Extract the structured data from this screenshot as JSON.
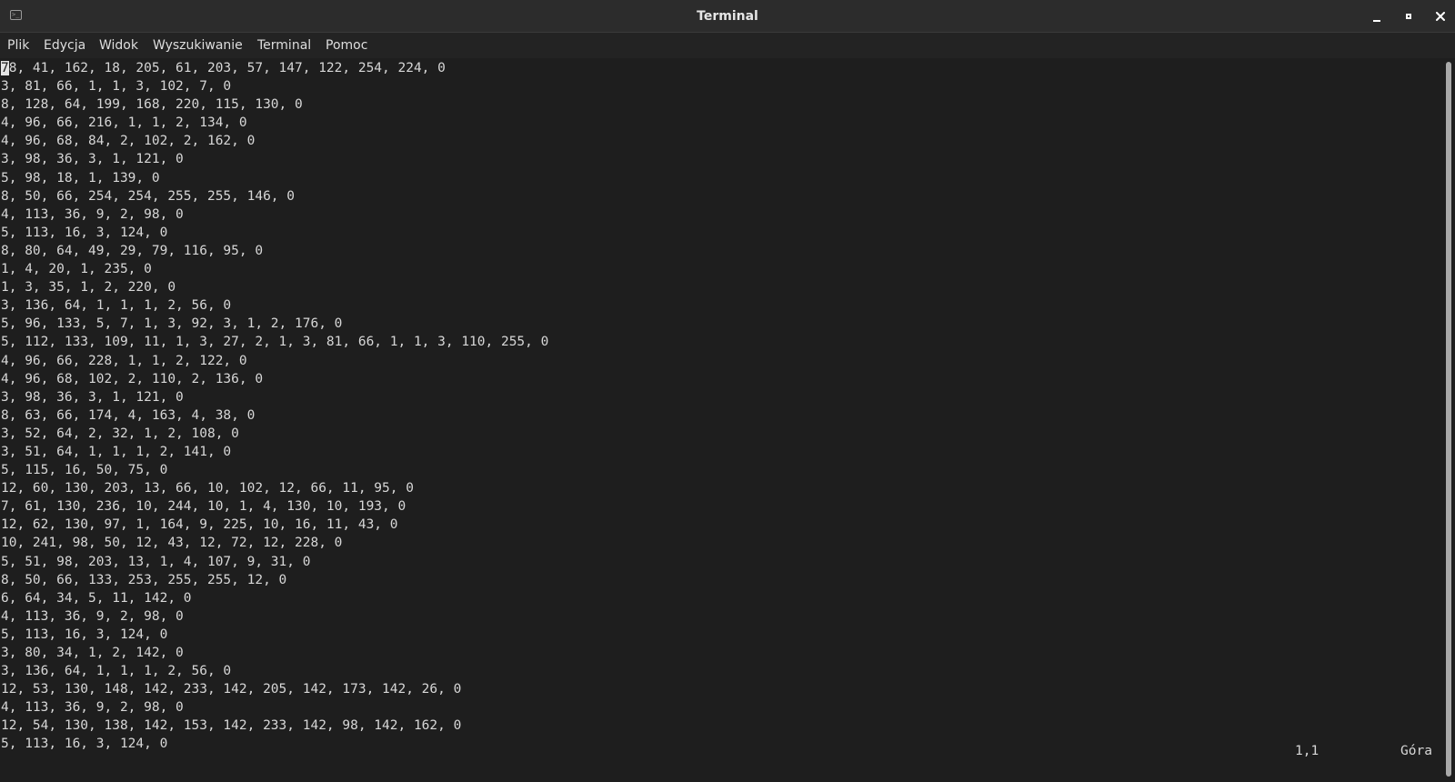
{
  "window": {
    "title": "Terminal"
  },
  "menu": {
    "items": [
      "Plik",
      "Edycja",
      "Widok",
      "Wyszukiwanie",
      "Terminal",
      "Pomoc"
    ]
  },
  "terminal": {
    "cursor_char": "7",
    "first_line_rest": "8, 41, 162, 18, 205, 61, 203, 57, 147, 122, 254, 224, 0",
    "lines": [
      "3, 81, 66, 1, 1, 3, 102, 7, 0",
      "8, 128, 64, 199, 168, 220, 115, 130, 0",
      "4, 96, 66, 216, 1, 1, 2, 134, 0",
      "4, 96, 68, 84, 2, 102, 2, 162, 0",
      "3, 98, 36, 3, 1, 121, 0",
      "5, 98, 18, 1, 139, 0",
      "8, 50, 66, 254, 254, 255, 255, 146, 0",
      "4, 113, 36, 9, 2, 98, 0",
      "5, 113, 16, 3, 124, 0",
      "8, 80, 64, 49, 29, 79, 116, 95, 0",
      "1, 4, 20, 1, 235, 0",
      "1, 3, 35, 1, 2, 220, 0",
      "3, 136, 64, 1, 1, 1, 2, 56, 0",
      "5, 96, 133, 5, 7, 1, 3, 92, 3, 1, 2, 176, 0",
      "5, 112, 133, 109, 11, 1, 3, 27, 2, 1, 3, 81, 66, 1, 1, 3, 110, 255, 0",
      "4, 96, 66, 228, 1, 1, 2, 122, 0",
      "4, 96, 68, 102, 2, 110, 2, 136, 0",
      "3, 98, 36, 3, 1, 121, 0",
      "8, 63, 66, 174, 4, 163, 4, 38, 0",
      "3, 52, 64, 2, 32, 1, 2, 108, 0",
      "3, 51, 64, 1, 1, 1, 2, 141, 0",
      "5, 115, 16, 50, 75, 0",
      "12, 60, 130, 203, 13, 66, 10, 102, 12, 66, 11, 95, 0",
      "7, 61, 130, 236, 10, 244, 10, 1, 4, 130, 10, 193, 0",
      "12, 62, 130, 97, 1, 164, 9, 225, 10, 16, 11, 43, 0",
      "10, 241, 98, 50, 12, 43, 12, 72, 12, 228, 0",
      "5, 51, 98, 203, 13, 1, 4, 107, 9, 31, 0",
      "8, 50, 66, 133, 253, 255, 255, 12, 0",
      "6, 64, 34, 5, 11, 142, 0",
      "4, 113, 36, 9, 2, 98, 0",
      "5, 113, 16, 3, 124, 0",
      "3, 80, 34, 1, 2, 142, 0",
      "3, 136, 64, 1, 1, 1, 2, 56, 0",
      "12, 53, 130, 148, 142, 233, 142, 205, 142, 173, 142, 26, 0",
      "4, 113, 36, 9, 2, 98, 0",
      "12, 54, 130, 138, 142, 153, 142, 233, 142, 98, 142, 162, 0",
      "5, 113, 16, 3, 124, 0"
    ],
    "status_position": "1,1",
    "status_scroll": "Góra"
  },
  "colors": {
    "background": "#1e1e1e",
    "titlebar": "#2c2c2c",
    "menubar": "#232323",
    "text": "#d7d7d7",
    "scrollbar_thumb": "#a9a9a9"
  }
}
